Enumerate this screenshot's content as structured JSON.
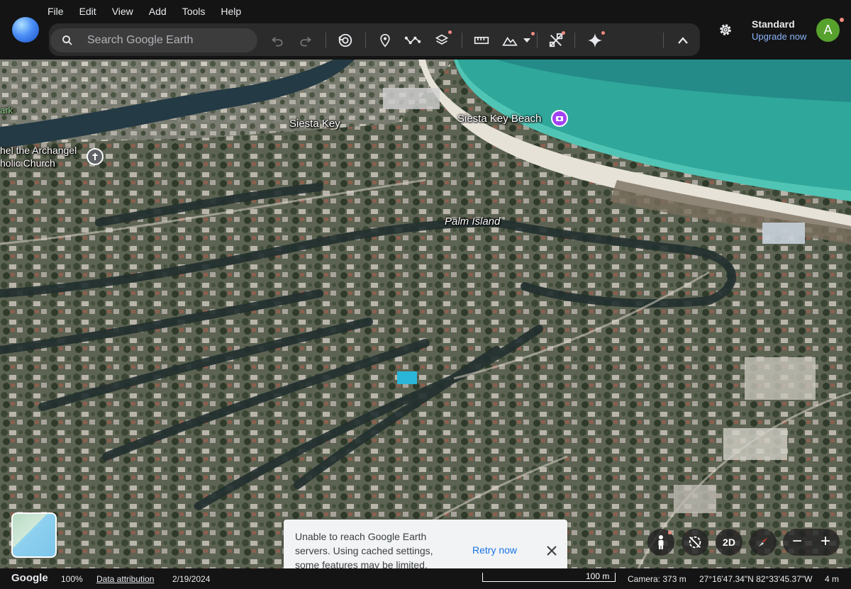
{
  "menu": {
    "items": [
      "File",
      "Edit",
      "View",
      "Add",
      "Tools",
      "Help"
    ]
  },
  "search": {
    "placeholder": "Search Google Earth"
  },
  "toolbar": {
    "icons": [
      "undo-icon",
      "redo-icon",
      "history-icon",
      "placemark-icon",
      "path-icon",
      "layers-icon",
      "measure-icon",
      "terrain-icon",
      "tools-icon",
      "gemini-icon",
      "collapse-icon"
    ]
  },
  "account": {
    "plan": "Standard",
    "upgrade": "Upgrade now",
    "avatar_letter": "A"
  },
  "map": {
    "labels": {
      "siesta_key": "Siesta Key",
      "siesta_key_beach": "Siesta Key Beach",
      "palm_island": "Palm Island",
      "church_line1": "hel the Archangel",
      "church_line2": "holic Church",
      "park": "ark"
    },
    "controls": {
      "two_d": "2D"
    },
    "scale": "100 m"
  },
  "toast": {
    "message": "Unable to reach Google Earth servers. Using cached settings, some features may be limited.",
    "retry": "Retry now"
  },
  "status": {
    "brand": "Google",
    "zoom": "100%",
    "attribution": "Data attribution",
    "date": "2/19/2024",
    "camera": "Camera: 373 m",
    "coords": "27°16'47.34\"N 82°33'45.37\"W",
    "elevation": "4 m"
  },
  "colors": {
    "accent": "#8ab4f8",
    "avatar": "#57a12d",
    "ocean": "#2fa79a",
    "toast_link": "#1a73e8"
  }
}
